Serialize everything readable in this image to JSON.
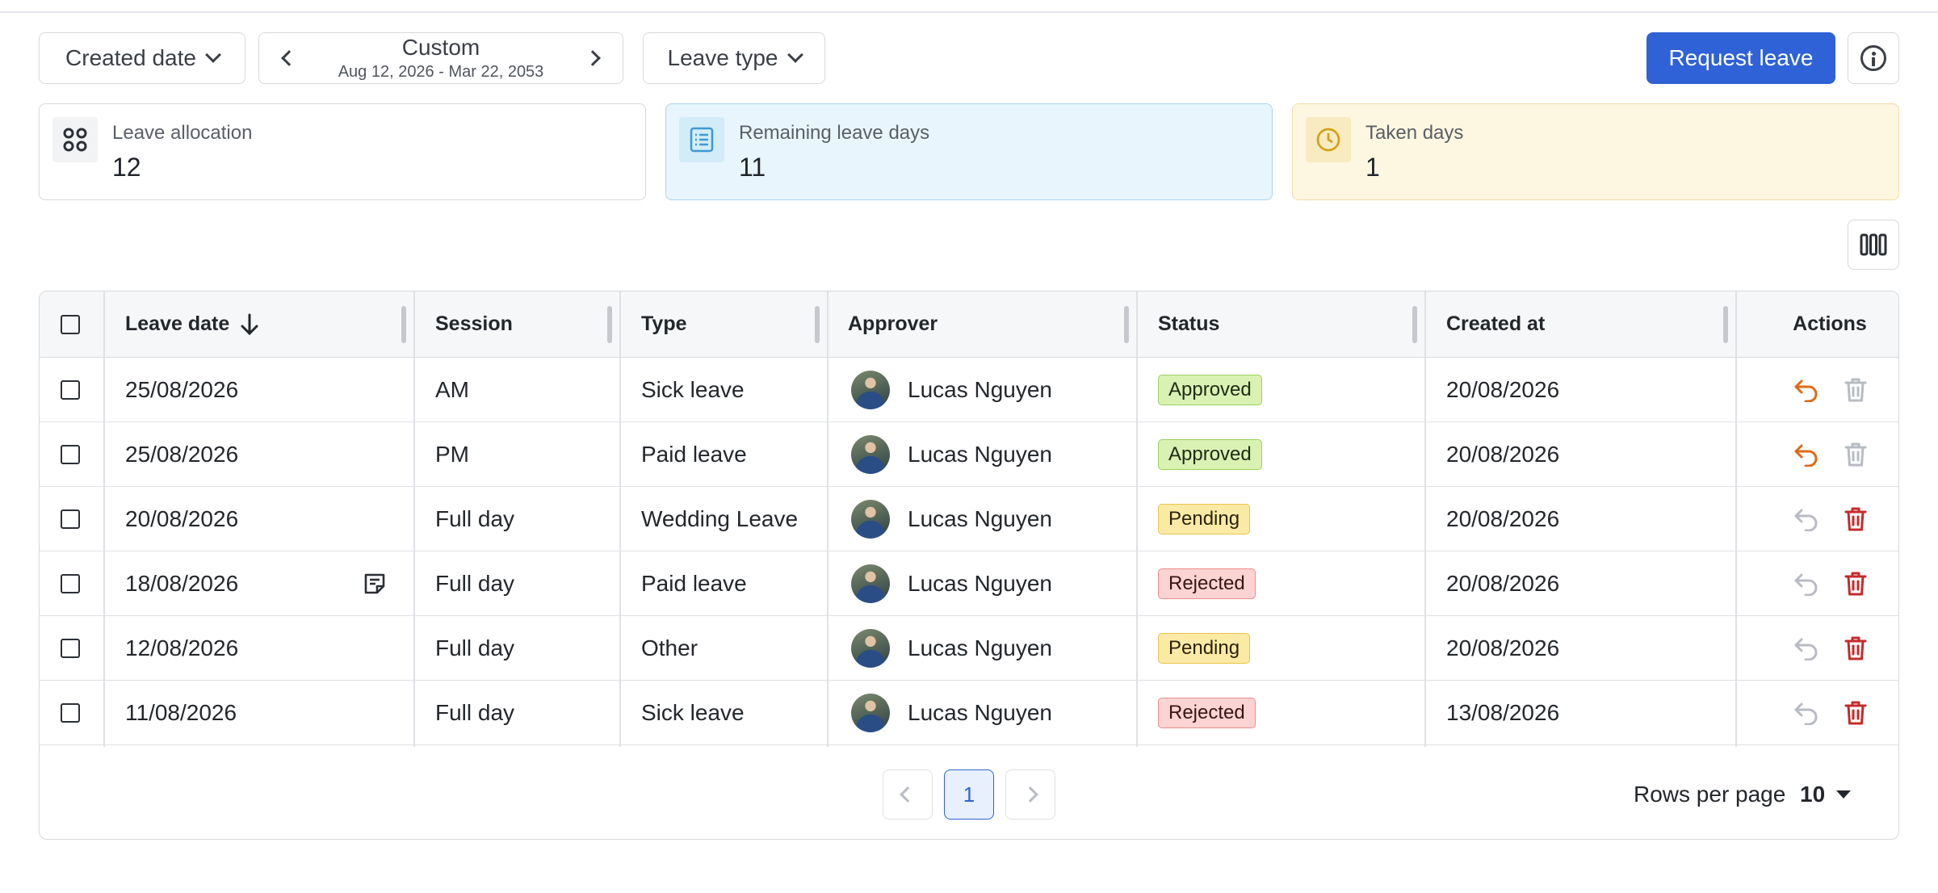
{
  "toolbar": {
    "created_date_label": "Created date",
    "range_title": "Custom",
    "range_subtitle": "Aug 12, 2026 - Mar 22, 2053",
    "leave_type_label": "Leave type",
    "request_label": "Request leave"
  },
  "cards": {
    "allocation": {
      "label": "Leave allocation",
      "value": "12",
      "icon": "grid-icon"
    },
    "remaining": {
      "label": "Remaining leave days",
      "value": "11",
      "icon": "list-icon",
      "accent": "#e8f5fc"
    },
    "taken": {
      "label": "Taken days",
      "value": "1",
      "icon": "clock-icon",
      "accent": "#fdf6e1"
    }
  },
  "table": {
    "headers": {
      "leave_date": "Leave date",
      "session": "Session",
      "type": "Type",
      "approver": "Approver",
      "status": "Status",
      "created_at": "Created at",
      "actions": "Actions"
    },
    "rows": [
      {
        "leave_date": "25/08/2026",
        "session": "AM",
        "type": "Sick leave",
        "approver": "Lucas Nguyen",
        "status": "Approved",
        "created_at": "20/08/2026",
        "note": false
      },
      {
        "leave_date": "25/08/2026",
        "session": "PM",
        "type": "Paid leave",
        "approver": "Lucas Nguyen",
        "status": "Approved",
        "created_at": "20/08/2026",
        "note": false
      },
      {
        "leave_date": "20/08/2026",
        "session": "Full day",
        "type": "Wedding Leave",
        "approver": "Lucas Nguyen",
        "status": "Pending",
        "created_at": "20/08/2026",
        "note": false
      },
      {
        "leave_date": "18/08/2026",
        "session": "Full day",
        "type": "Paid leave",
        "approver": "Lucas Nguyen",
        "status": "Rejected",
        "created_at": "20/08/2026",
        "note": true
      },
      {
        "leave_date": "12/08/2026",
        "session": "Full day",
        "type": "Other",
        "approver": "Lucas Nguyen",
        "status": "Pending",
        "created_at": "20/08/2026",
        "note": false
      },
      {
        "leave_date": "11/08/2026",
        "session": "Full day",
        "type": "Sick leave",
        "approver": "Lucas Nguyen",
        "status": "Rejected",
        "created_at": "13/08/2026",
        "note": false
      }
    ]
  },
  "pagination": {
    "current_page": "1",
    "rows_per_page_label": "Rows per page",
    "rows_per_page_value": "10"
  },
  "colors": {
    "primary": "#2f62d6",
    "undo_active": "#dc6b19",
    "delete_active": "#c42b2b",
    "disabled_icon": "#b8bcc2"
  }
}
